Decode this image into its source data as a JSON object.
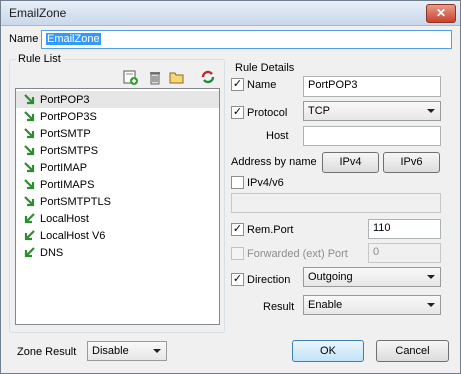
{
  "window": {
    "title": "EmailZone"
  },
  "name_field": {
    "label": "Name",
    "value": "EmailZone"
  },
  "rule_list": {
    "title": "Rule List",
    "items": [
      "PortPOP3",
      "PortPOP3S",
      "PortSMTP",
      "PortSMTPS",
      "PortIMAP",
      "PortIMAPS",
      "PortSMTPTLS",
      "LocalHost",
      "LocalHost V6",
      "DNS"
    ]
  },
  "rule_details": {
    "title": "Rule Details",
    "name_label": "Name",
    "name_value": "PortPOP3",
    "protocol_label": "Protocol",
    "protocol_value": "TCP",
    "host_label": "Host",
    "host_value": "",
    "address_by_name_label": "Address by name",
    "ipv4_button": "IPv4",
    "ipv6_button": "IPv6",
    "ipv4v6_label": "IPv4/v6",
    "ipv4v6_value": "",
    "remport_label": "Rem.Port",
    "remport_value": "110",
    "forwarded_label": "Forwarded (ext) Port",
    "forwarded_value": "0",
    "direction_label": "Direction",
    "direction_value": "Outgoing",
    "result_label": "Result",
    "result_value": "Enable"
  },
  "zone_result": {
    "label": "Zone Result",
    "value": "Disable"
  },
  "buttons": {
    "ok": "OK",
    "cancel": "Cancel"
  },
  "colors": {
    "selection": "#3399ff",
    "accent_green": "#2e8b2e"
  }
}
